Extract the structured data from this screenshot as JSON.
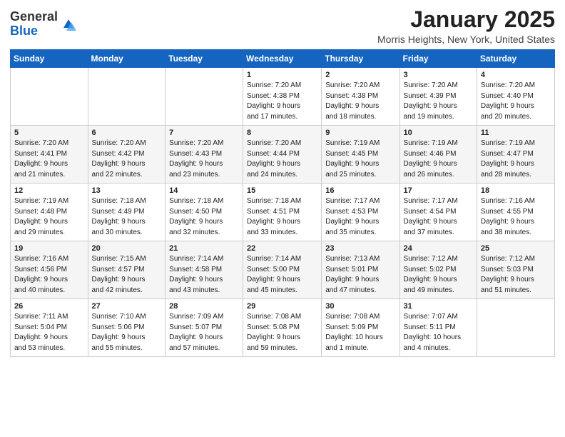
{
  "logo": {
    "general": "General",
    "blue": "Blue"
  },
  "header": {
    "month": "January 2025",
    "location": "Morris Heights, New York, United States"
  },
  "weekdays": [
    "Sunday",
    "Monday",
    "Tuesday",
    "Wednesday",
    "Thursday",
    "Friday",
    "Saturday"
  ],
  "weeks": [
    [
      {
        "day": "",
        "info": ""
      },
      {
        "day": "",
        "info": ""
      },
      {
        "day": "",
        "info": ""
      },
      {
        "day": "1",
        "info": "Sunrise: 7:20 AM\nSunset: 4:38 PM\nDaylight: 9 hours\nand 17 minutes."
      },
      {
        "day": "2",
        "info": "Sunrise: 7:20 AM\nSunset: 4:38 PM\nDaylight: 9 hours\nand 18 minutes."
      },
      {
        "day": "3",
        "info": "Sunrise: 7:20 AM\nSunset: 4:39 PM\nDaylight: 9 hours\nand 19 minutes."
      },
      {
        "day": "4",
        "info": "Sunrise: 7:20 AM\nSunset: 4:40 PM\nDaylight: 9 hours\nand 20 minutes."
      }
    ],
    [
      {
        "day": "5",
        "info": "Sunrise: 7:20 AM\nSunset: 4:41 PM\nDaylight: 9 hours\nand 21 minutes."
      },
      {
        "day": "6",
        "info": "Sunrise: 7:20 AM\nSunset: 4:42 PM\nDaylight: 9 hours\nand 22 minutes."
      },
      {
        "day": "7",
        "info": "Sunrise: 7:20 AM\nSunset: 4:43 PM\nDaylight: 9 hours\nand 23 minutes."
      },
      {
        "day": "8",
        "info": "Sunrise: 7:20 AM\nSunset: 4:44 PM\nDaylight: 9 hours\nand 24 minutes."
      },
      {
        "day": "9",
        "info": "Sunrise: 7:19 AM\nSunset: 4:45 PM\nDaylight: 9 hours\nand 25 minutes."
      },
      {
        "day": "10",
        "info": "Sunrise: 7:19 AM\nSunset: 4:46 PM\nDaylight: 9 hours\nand 26 minutes."
      },
      {
        "day": "11",
        "info": "Sunrise: 7:19 AM\nSunset: 4:47 PM\nDaylight: 9 hours\nand 28 minutes."
      }
    ],
    [
      {
        "day": "12",
        "info": "Sunrise: 7:19 AM\nSunset: 4:48 PM\nDaylight: 9 hours\nand 29 minutes."
      },
      {
        "day": "13",
        "info": "Sunrise: 7:18 AM\nSunset: 4:49 PM\nDaylight: 9 hours\nand 30 minutes."
      },
      {
        "day": "14",
        "info": "Sunrise: 7:18 AM\nSunset: 4:50 PM\nDaylight: 9 hours\nand 32 minutes."
      },
      {
        "day": "15",
        "info": "Sunrise: 7:18 AM\nSunset: 4:51 PM\nDaylight: 9 hours\nand 33 minutes."
      },
      {
        "day": "16",
        "info": "Sunrise: 7:17 AM\nSunset: 4:53 PM\nDaylight: 9 hours\nand 35 minutes."
      },
      {
        "day": "17",
        "info": "Sunrise: 7:17 AM\nSunset: 4:54 PM\nDaylight: 9 hours\nand 37 minutes."
      },
      {
        "day": "18",
        "info": "Sunrise: 7:16 AM\nSunset: 4:55 PM\nDaylight: 9 hours\nand 38 minutes."
      }
    ],
    [
      {
        "day": "19",
        "info": "Sunrise: 7:16 AM\nSunset: 4:56 PM\nDaylight: 9 hours\nand 40 minutes."
      },
      {
        "day": "20",
        "info": "Sunrise: 7:15 AM\nSunset: 4:57 PM\nDaylight: 9 hours\nand 42 minutes."
      },
      {
        "day": "21",
        "info": "Sunrise: 7:14 AM\nSunset: 4:58 PM\nDaylight: 9 hours\nand 43 minutes."
      },
      {
        "day": "22",
        "info": "Sunrise: 7:14 AM\nSunset: 5:00 PM\nDaylight: 9 hours\nand 45 minutes."
      },
      {
        "day": "23",
        "info": "Sunrise: 7:13 AM\nSunset: 5:01 PM\nDaylight: 9 hours\nand 47 minutes."
      },
      {
        "day": "24",
        "info": "Sunrise: 7:12 AM\nSunset: 5:02 PM\nDaylight: 9 hours\nand 49 minutes."
      },
      {
        "day": "25",
        "info": "Sunrise: 7:12 AM\nSunset: 5:03 PM\nDaylight: 9 hours\nand 51 minutes."
      }
    ],
    [
      {
        "day": "26",
        "info": "Sunrise: 7:11 AM\nSunset: 5:04 PM\nDaylight: 9 hours\nand 53 minutes."
      },
      {
        "day": "27",
        "info": "Sunrise: 7:10 AM\nSunset: 5:06 PM\nDaylight: 9 hours\nand 55 minutes."
      },
      {
        "day": "28",
        "info": "Sunrise: 7:09 AM\nSunset: 5:07 PM\nDaylight: 9 hours\nand 57 minutes."
      },
      {
        "day": "29",
        "info": "Sunrise: 7:08 AM\nSunset: 5:08 PM\nDaylight: 9 hours\nand 59 minutes."
      },
      {
        "day": "30",
        "info": "Sunrise: 7:08 AM\nSunset: 5:09 PM\nDaylight: 10 hours\nand 1 minute."
      },
      {
        "day": "31",
        "info": "Sunrise: 7:07 AM\nSunset: 5:11 PM\nDaylight: 10 hours\nand 4 minutes."
      },
      {
        "day": "",
        "info": ""
      }
    ]
  ]
}
